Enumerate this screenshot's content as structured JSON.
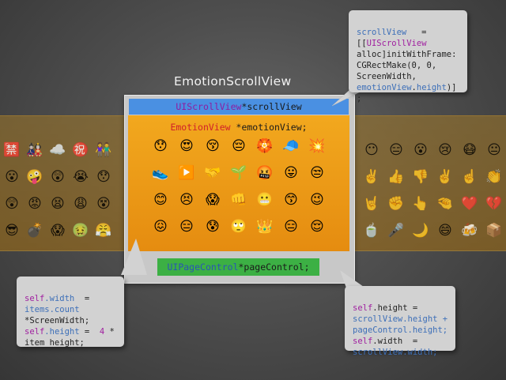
{
  "title": "EmotionScrollView",
  "scroll_view_label": {
    "type": "UIScrollView",
    "var": " *scrollView"
  },
  "emotion_view_label": {
    "type": "EmotionView",
    "var": " *emotionView;"
  },
  "page_control_label": {
    "type": "UIPageControl",
    "var": "  *pageControl;"
  },
  "callout_top": {
    "line1_a": "scrollView",
    "line1_b": "   =",
    "line2_a": "[[",
    "line2_b": "UIScrollView",
    "line3_a": "alloc",
    "line3_b": "]initWithFrame:",
    "line4": "CGRectMake(0, 0,",
    "line5": "ScreenWidth,",
    "line6_a": "emotionView",
    "line6_b": ".",
    "line6_c": "height",
    "line6_d": ")]",
    "line7": ";"
  },
  "callout_left": {
    "line1_a": "self",
    "line1_b": ".width",
    "line1_c": "  =",
    "line2": "items.count",
    "line3": "*ScreenWidth;",
    "line4_a": "self",
    "line4_b": ".height",
    "line4_c": " =  ",
    "line4_d": "4",
    "line4_e": " *",
    "line5": "item_height;"
  },
  "callout_right": {
    "line1_a": "self",
    "line1_b": ".height =",
    "line2": "scrollView.height +",
    "line3": "pageControl.height;",
    "line4_a": "self",
    "line4_b": ".width  =",
    "line5": "scrollView.width;"
  },
  "icons": {
    "left_grid": [
      [
        "🈲",
        "🎎",
        "☁️",
        "㊗️",
        "👫"
      ],
      [
        "😮",
        "🤪",
        "😲",
        "😭",
        "😯"
      ],
      [
        "😲",
        "😡",
        "😫",
        "😩",
        "😵"
      ],
      [
        "😎",
        "💣",
        "😱",
        "🤢",
        "😤"
      ]
    ],
    "center_grid": [
      [
        "😯",
        "😍",
        "😚",
        "😔",
        "🏵️",
        "🧢",
        "💥"
      ],
      [
        "👟",
        "▶️",
        "🤝",
        "🌱",
        "🤬",
        "😛",
        "😒"
      ],
      [
        "😊",
        "😣",
        "😱",
        "👊",
        "😬",
        "😙",
        "😉"
      ],
      [
        "😖",
        "😑",
        "😰",
        "🙄",
        "👑",
        "😑",
        "😌"
      ]
    ],
    "right_grid": [
      [
        "😶",
        "😑",
        "😮",
        "😢",
        "😷",
        "😐"
      ],
      [
        "✌️",
        "👍",
        "👎",
        "✌️",
        "☝️",
        "👏"
      ],
      [
        "🤘",
        "✊",
        "👆",
        "🤏",
        "❤️",
        "💔"
      ],
      [
        "🍵",
        "🎤",
        "🌙",
        "😄",
        "🍻",
        "📦"
      ]
    ]
  },
  "colors": {
    "scroll_view": "#4a90e2",
    "emotion_view": "#f0a01e",
    "page_control": "#3cb044",
    "panel": "#c8c8c8",
    "callout": "#d2d2d2"
  }
}
